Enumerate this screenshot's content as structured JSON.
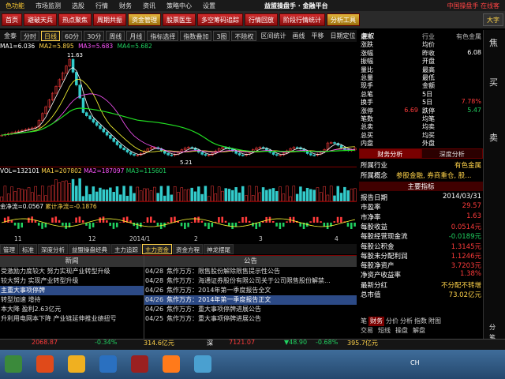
{
  "menu": {
    "brand": "色功能",
    "items": [
      "市场监测",
      "选股",
      "行情",
      "财务",
      "资讯",
      "策略中心",
      "设置"
    ],
    "center_title": "益盟操盘手 · 金融平台",
    "right": "中国操盘手   在线客"
  },
  "toolbar": {
    "buttons": [
      "首页",
      "避破天兵",
      "热点聚焦",
      "周期共振",
      "资金管理",
      "股票医生",
      "多空筹码追踪",
      "行情回放",
      "阶段行情统计",
      "分析工具"
    ],
    "right_button": "大字"
  },
  "chart_toolbar": {
    "name": "金泰",
    "buttons": [
      "分时",
      "日线",
      "60分",
      "30分",
      "周线",
      "月线",
      "指标选择",
      "指数叠加",
      "3图",
      "不除权",
      "区间统计",
      "画线",
      "平移",
      "日期定位",
      "复权"
    ],
    "active": "日线"
  },
  "ma_legend": {
    "label": "MA1=6.036",
    "ma2": "MA2=5.895",
    "ma3": "MA3=5.683",
    "ma4": "MA4=5.682",
    "high_label": "11.63",
    "low_label": "5.21",
    "colors": {
      "ma1": "#ffffff",
      "ma2": "#ffff33",
      "ma3": "#ff55ff",
      "ma4": "#22dd22"
    }
  },
  "volume_legend": {
    "label": "VOL=132101",
    "ma1": "MA1=207802",
    "ma2": "MA2=187097",
    "ma3": "MA3=115601"
  },
  "flow_legend": {
    "label": "金净流=0.0567",
    "cum": "累计净流=-0.1876"
  },
  "xaxis": [
    "11",
    "12",
    "2014/1",
    "2",
    "3",
    "4"
  ],
  "sub_tabs": {
    "items": [
      "管理",
      "标准",
      "深度分析",
      "益盟操盘经典",
      "主力追踪",
      "主力资金",
      "资金方程",
      "神龙摆尾"
    ],
    "active": "主力资金"
  },
  "quote": {
    "rows": [
      {
        "l1": "最新",
        "v1": "",
        "l2": "行业",
        "v2": "有色金属",
        "l2c": "gray",
        "v2c": "gray"
      },
      {
        "l1": "涨跌",
        "v1": "",
        "l2": "均价",
        "v2": ""
      },
      {
        "l1": "涨幅",
        "v1": "",
        "l2": "昨收",
        "v2": "6.08",
        "v2c": "white"
      },
      {
        "l1": "振幅",
        "v1": "",
        "l2": "开盘",
        "v2": ""
      },
      {
        "l1": "量比",
        "v1": "",
        "l2": "最高",
        "v2": ""
      },
      {
        "l1": "总量",
        "v1": "",
        "l2": "最低",
        "v2": ""
      },
      {
        "l1": "现手",
        "v1": "",
        "l2": "金额",
        "v2": ""
      },
      {
        "l1": "总笔",
        "v1": "",
        "l2": "5日",
        "v2": ""
      },
      {
        "l1": "换手",
        "v1": "",
        "l2": "5日",
        "v2": "7.78%",
        "v2c": "red"
      },
      {
        "l1": "涨停",
        "v1": "6.69",
        "l2": "跌停",
        "v2": "5.47",
        "v1c": "red",
        "v2c": "green"
      },
      {
        "l1": "笔数",
        "v1": "",
        "l2": "均笔",
        "v2": ""
      },
      {
        "l1": "总卖",
        "v1": "",
        "l2": "均卖",
        "v2": ""
      },
      {
        "l1": "总买",
        "v1": "",
        "l2": "均买",
        "v2": ""
      },
      {
        "l1": "内盘",
        "v1": "",
        "l2": "外盘",
        "v2": ""
      }
    ]
  },
  "fund_tabs": {
    "items": [
      "财务分析",
      "深度分析"
    ],
    "active": "财务分析"
  },
  "fundamentals": {
    "industry_label": "所属行业",
    "industry": "有色金属",
    "concept_label": "所属概念",
    "concept": "参股金融, 券商重仓, 股...",
    "header": "主要指标",
    "rows": [
      {
        "label": "报告日期",
        "value": "2014/03/31",
        "color": "white"
      },
      {
        "label": "市盈率",
        "value": "29.57",
        "color": "red"
      },
      {
        "label": "市净率",
        "value": "1.63",
        "color": "red"
      },
      {
        "label": "每股收益",
        "value": "0.0514元",
        "color": "red"
      },
      {
        "label": "每股经营现金流",
        "value": "-0.0189元",
        "color": "green"
      },
      {
        "label": "每股公积金",
        "value": "1.3145元",
        "color": "red"
      },
      {
        "label": "每股未分配利润",
        "value": "1.1246元",
        "color": "red"
      },
      {
        "label": "每股净资产",
        "value": "3.7203元",
        "color": "red"
      },
      {
        "label": "净资产收益率",
        "value": "1.38%",
        "color": "red"
      },
      {
        "label": "最新分红",
        "value": "不分配不转增",
        "color": "yellow"
      },
      {
        "label": "总市值",
        "value": "73.02亿元",
        "color": "yellow"
      }
    ]
  },
  "bottom_tabs": {
    "items": [
      "笔",
      "财务",
      "分价",
      "分析",
      "指数",
      "附图"
    ],
    "active": "财务"
  },
  "bottom_tabs2": [
    "交易",
    "短线",
    "操盘",
    "解盘"
  ],
  "right_bar": [
    "焦",
    "买",
    "卖",
    "分笔"
  ],
  "news": {
    "title": "新闻",
    "items": [
      "受激励力度较大 努力实现产业转型升级",
      "较大努力 实现产业转型升级",
      "主重大事项停牌",
      "转型加速 增持",
      "本大降 盈利2.63亿元",
      "升利用电网本下降 产业链延伸推业绩扭亏"
    ],
    "selected": 2
  },
  "announcements": {
    "title": "公告",
    "items": [
      {
        "date": "04/28",
        "text": "焦作万方：限售股份解除限售提示性公告"
      },
      {
        "date": "04/28",
        "text": "焦作万方：海通证券股份有限公司关于公司限售股份解禁..."
      },
      {
        "date": "04/26",
        "text": "焦作万方：2014年第一季度报告全文"
      },
      {
        "date": "04/26",
        "text": "焦作万方：2014年第一季度报告正文"
      },
      {
        "date": "04/26",
        "text": "焦作万方：重大事项停牌进展公告"
      },
      {
        "date": "04/25",
        "text": "焦作万方：重大事项停牌进展公告"
      }
    ],
    "selected": 3
  },
  "ticker": {
    "items": [
      {
        "text": "益盟操盘手关于严禁代客理财的声明",
        "color": "white"
      },
      {
        "text": "标题可点击",
        "color": "yellow"
      },
      {
        "text": "【活动】爱“评”才会赢,300元话费",
        "color": "yellow"
      },
      {
        "text": "光泽",
        "color": "white"
      },
      {
        "text": "2133.6",
        "color": "red"
      },
      {
        "text": "-4.44",
        "color": "green"
      },
      {
        "text": "-0.21%",
        "color": "green"
      },
      {
        "text": "1872亿元",
        "color": "yellow"
      }
    ],
    "row1": [
      {
        "text": "2068.87",
        "color": "red"
      },
      {
        "text": "-0.34%",
        "color": "green"
      },
      {
        "text": "314.6亿元",
        "color": "yellow"
      },
      {
        "text": "深",
        "color": "white"
      },
      {
        "text": "7121.07",
        "color": "red"
      },
      {
        "text": "▼48.90",
        "color": "green"
      },
      {
        "text": "-0.68%",
        "color": "green"
      },
      {
        "text": "395.7亿元",
        "color": "yellow"
      }
    ]
  },
  "taskbar": {
    "ime": "CH"
  }
}
